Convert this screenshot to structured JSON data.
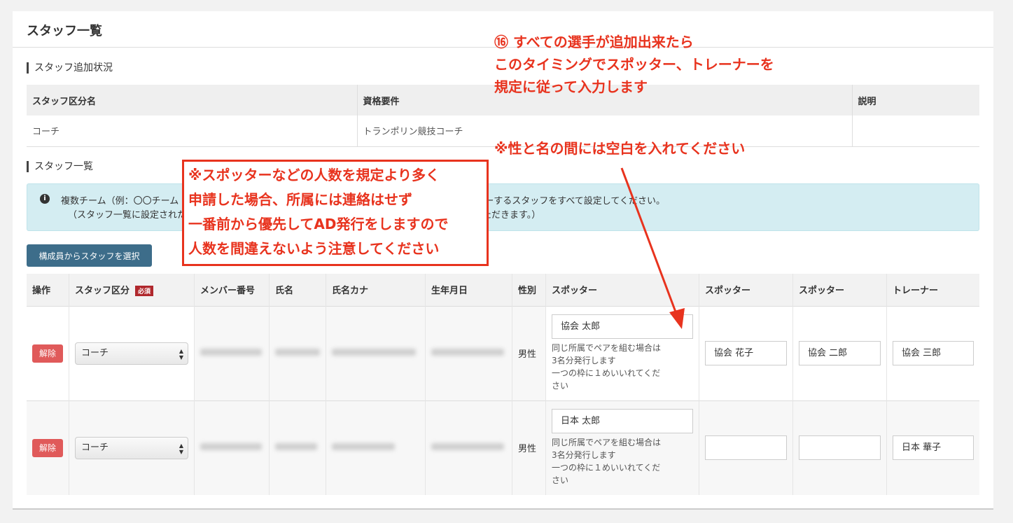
{
  "page_title": "スタッフ一覧",
  "requirements_section": {
    "heading": "スタッフ追加状況",
    "columns": [
      "スタッフ区分名",
      "資格要件",
      "説明"
    ],
    "rows": [
      {
        "category": "コーチ",
        "qualification": "トランポリン競技コーチ",
        "description": ""
      }
    ]
  },
  "staff_section": {
    "heading": "スタッフ一覧",
    "info_icon": "info-circle-icon",
    "info_line1": "複数チーム（例：〇〇チーム",
    "info_line1_tail": "ットリーするスタッフをすべて設定してください。",
    "info_line2": "（スタッフ一覧に設定された",
    "info_line2_tail": "ただきます。）",
    "select_button_label": "構成員からスタッフを選択",
    "columns": {
      "operation": "操作",
      "category": "スタッフ区分",
      "required_badge": "必須",
      "member_no": "メンバー番号",
      "name": "氏名",
      "name_kana": "氏名カナ",
      "birthdate": "生年月日",
      "gender": "性別",
      "spotter1": "スポッター",
      "spotter2": "スポッター",
      "spotter3": "スポッター",
      "trainer": "トレーナー"
    },
    "hint_text": [
      "同じ所属でペアを組む場合は",
      "3名分発行します",
      "一つの枠に１めいいれてくだ",
      "さい"
    ],
    "rows": [
      {
        "remove_label": "解除",
        "category_value": "コーチ",
        "gender": "男性",
        "spotter1": "協会 太郎",
        "spotter2": "協会 花子",
        "spotter3": "協会 二郎",
        "trainer": "協会 三郎"
      },
      {
        "remove_label": "解除",
        "category_value": "コーチ",
        "gender": "男性",
        "spotter1": "日本 太郎",
        "spotter2": "",
        "spotter3": "",
        "trainer": "日本 華子"
      }
    ]
  },
  "annotations": {
    "top_right": [
      "⑯ すべての選手が追加出来たら",
      "このタイミングでスポッター、トレーナーを",
      "規定に従って入力します"
    ],
    "note": "※性と名の間には空白を入れてください",
    "box": [
      "※スポッターなどの人数を規定より多く",
      "申請した場合、所属には連絡はせず",
      "一番前から優先してAD発行をしますので",
      "人数を間違えないよう注意してください"
    ],
    "accent_color": "#e8331e"
  }
}
